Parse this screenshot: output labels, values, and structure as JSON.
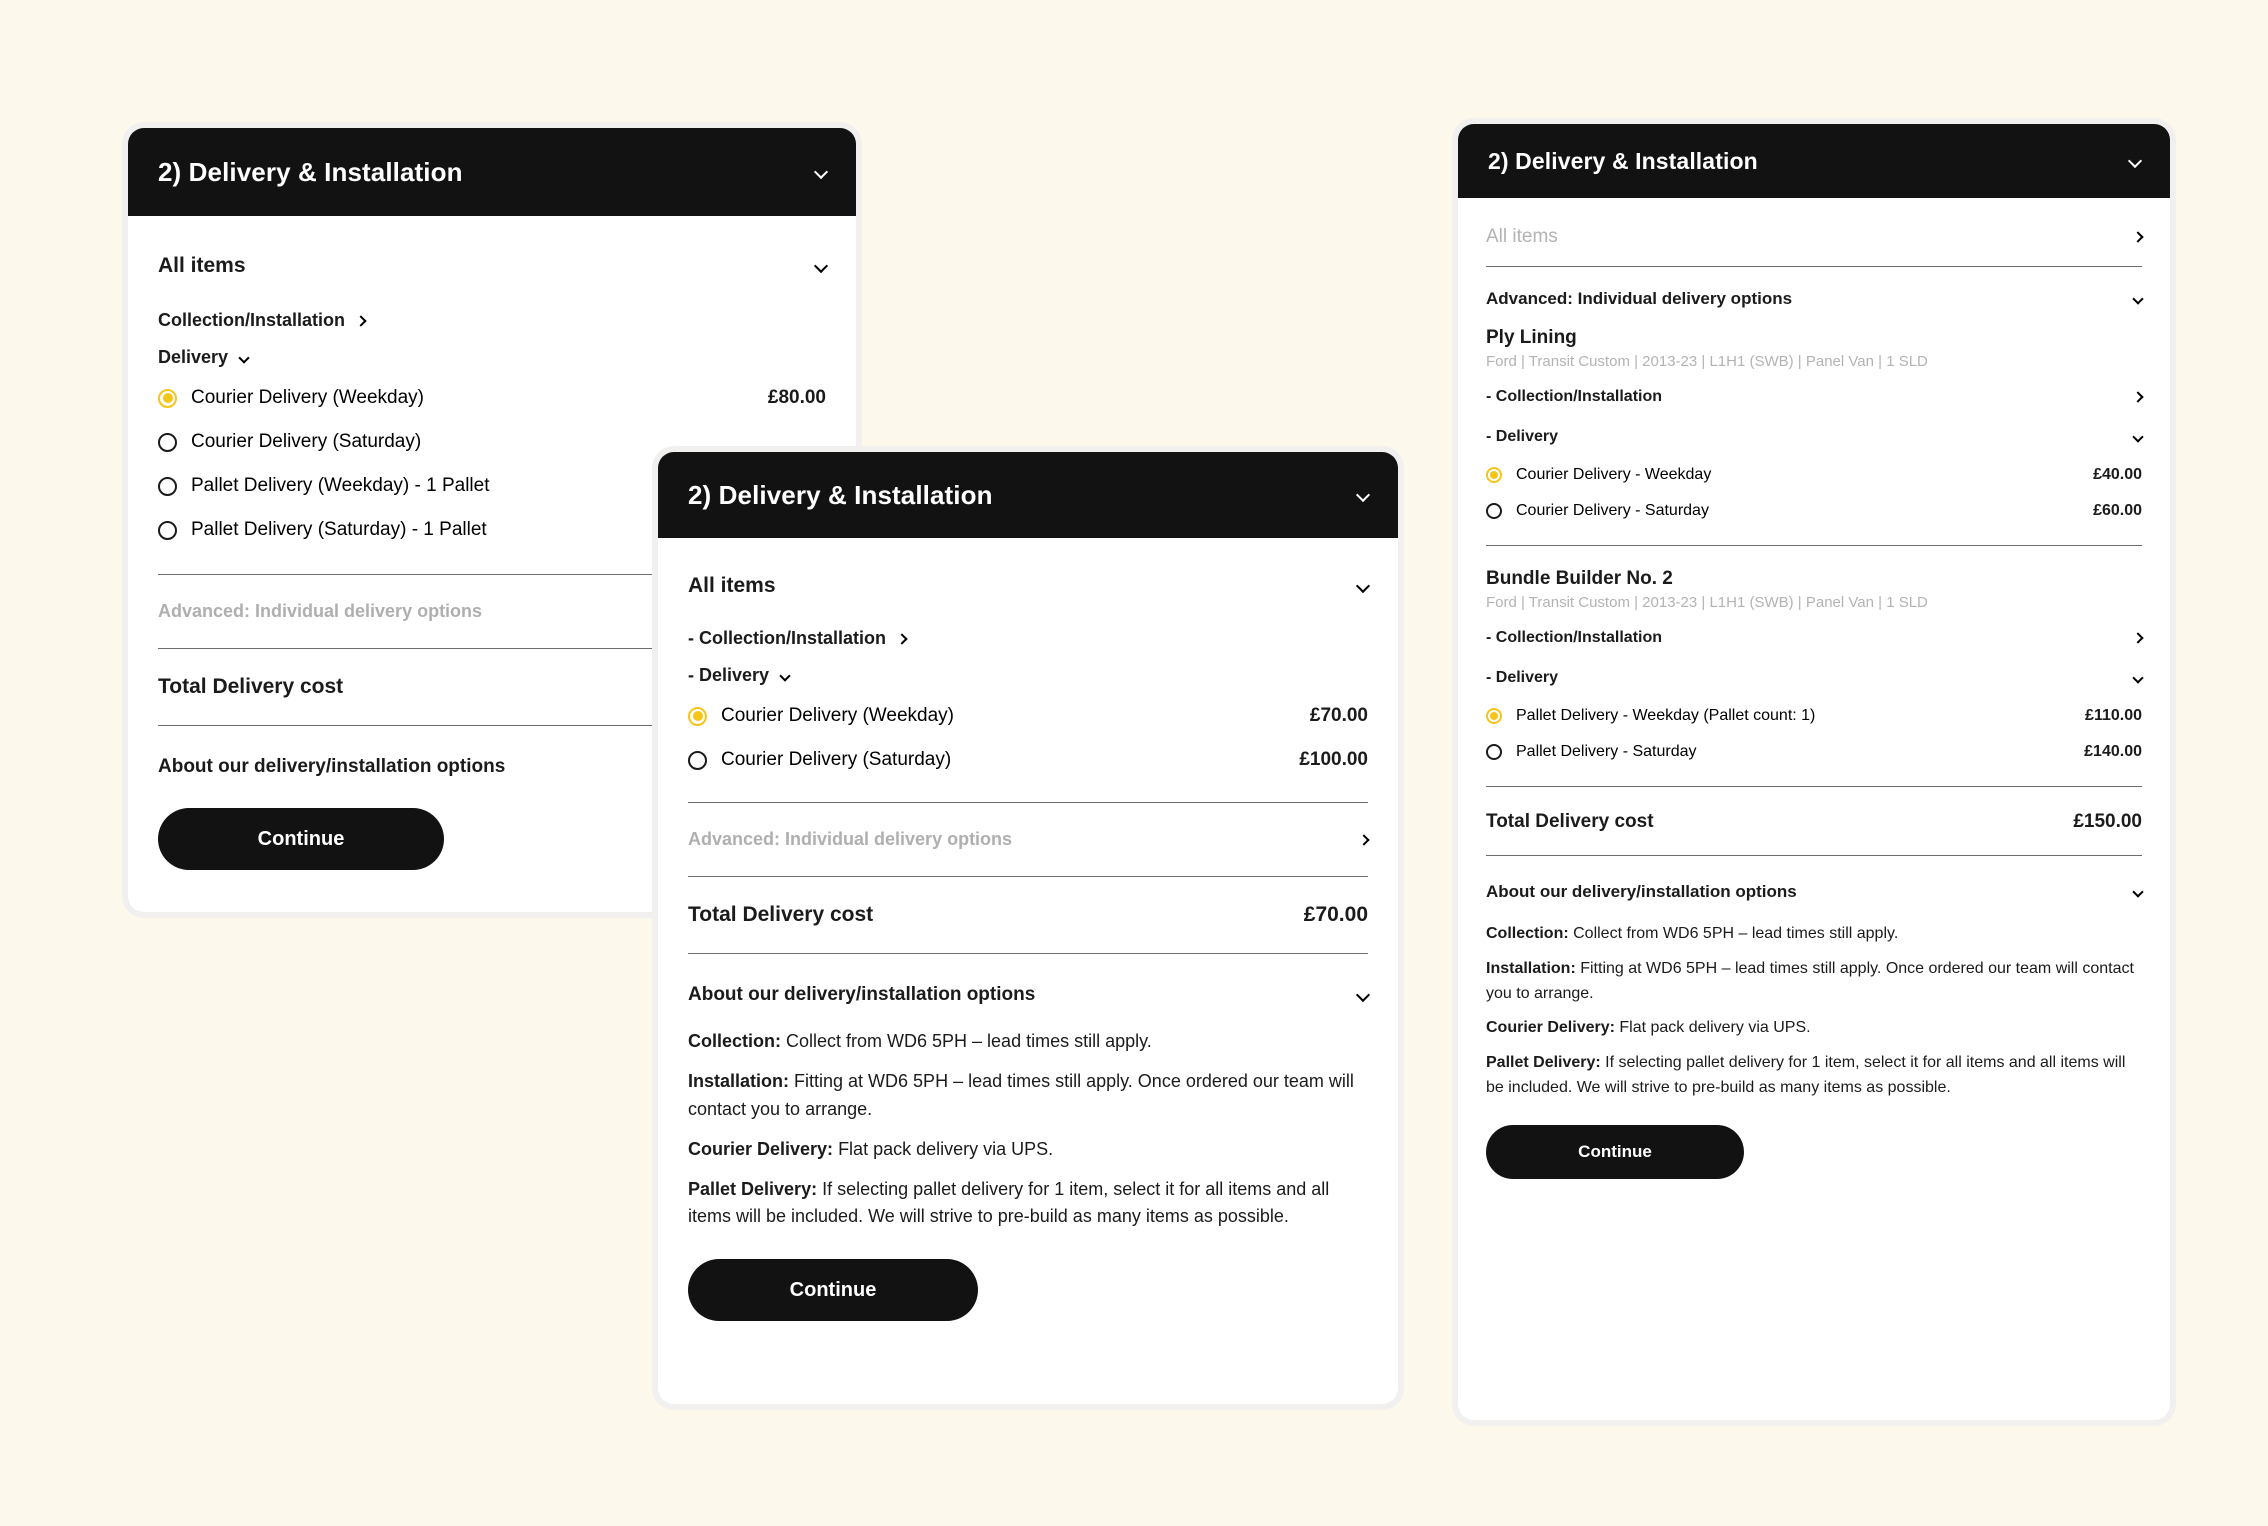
{
  "page": {
    "background_color": "#FDF8EC",
    "accent_color": "#F5C518",
    "header_bg_color": "#121212"
  },
  "card1": {
    "header_title": "2) Delivery & Installation",
    "all_items_label": "All items",
    "collection_label": "Collection/Installation",
    "delivery_label": "Delivery",
    "options": [
      {
        "label": "Courier Delivery (Weekday)",
        "price": "£80.00",
        "selected": true
      },
      {
        "label": "Courier Delivery (Saturday)",
        "price": "",
        "selected": false
      },
      {
        "label": "Pallet Delivery (Weekday) - 1 Pallet",
        "price": "",
        "selected": false
      },
      {
        "label": "Pallet Delivery (Saturday) - 1 Pallet",
        "price": "",
        "selected": false
      }
    ],
    "advanced_label": "Advanced: Individual delivery options",
    "total_label": "Total Delivery cost",
    "total_value": "",
    "about_label": "About our delivery/installation options",
    "continue_label": "Continue"
  },
  "card2": {
    "header_title": "2) Delivery & Installation",
    "all_items_label": "All items",
    "collection_label": "- Collection/Installation",
    "delivery_label": "- Delivery",
    "options": [
      {
        "label": "Courier Delivery (Weekday)",
        "price": "£70.00",
        "selected": true
      },
      {
        "label": "Courier Delivery (Saturday)",
        "price": "£100.00",
        "selected": false
      }
    ],
    "advanced_label": "Advanced: Individual delivery options",
    "total_label": "Total Delivery cost",
    "total_value": "£70.00",
    "about_label": "About our delivery/installation options",
    "info": [
      {
        "term": "Collection:",
        "text": " Collect from WD6 5PH – lead times still apply."
      },
      {
        "term": "Installation:",
        "text": " Fitting at WD6 5PH – lead times still apply. Once ordered our team will contact you to arrange."
      },
      {
        "term": "Courier Delivery:",
        "text": " Flat pack delivery via UPS."
      },
      {
        "term": "Pallet Delivery:",
        "text": " If selecting pallet delivery for 1 item, select it for all items and all items will be included. We will strive to pre-build as many items as possible."
      }
    ],
    "continue_label": "Continue"
  },
  "card3": {
    "header_title": "2) Delivery & Installation",
    "all_items_label": "All items",
    "advanced_label": "Advanced: Individual delivery options",
    "groups": [
      {
        "title": "Ply Lining",
        "subtitle": "Ford | Transit Custom | 2013-23 | L1H1 (SWB) | Panel Van | 1 SLD",
        "collection_label": "- Collection/Installation",
        "delivery_label": "- Delivery",
        "options": [
          {
            "label": "Courier Delivery - Weekday",
            "price": "£40.00",
            "selected": true
          },
          {
            "label": "Courier Delivery - Saturday",
            "price": "£60.00",
            "selected": false
          }
        ]
      },
      {
        "title": "Bundle Builder No. 2",
        "subtitle": "Ford | Transit Custom | 2013-23 | L1H1 (SWB) | Panel Van | 1 SLD",
        "collection_label": "- Collection/Installation",
        "delivery_label": "- Delivery",
        "options": [
          {
            "label": "Pallet Delivery - Weekday (Pallet count: 1)",
            "price": "£110.00",
            "selected": true
          },
          {
            "label": "Pallet Delivery - Saturday",
            "price": "£140.00",
            "selected": false
          }
        ]
      }
    ],
    "total_label": "Total Delivery cost",
    "total_value": "£150.00",
    "about_label": "About our delivery/installation options",
    "info": [
      {
        "term": "Collection:",
        "text": " Collect from WD6 5PH – lead times still apply."
      },
      {
        "term": "Installation:",
        "text": " Fitting at WD6 5PH – lead times still apply. Once ordered our team will contact you to arrange."
      },
      {
        "term": "Courier Delivery:",
        "text": " Flat pack delivery via UPS."
      },
      {
        "term": "Pallet Delivery:",
        "text": " If selecting pallet delivery for 1 item, select it for all items and all items will be included. We will strive to pre-build as many items as possible."
      }
    ],
    "continue_label": "Continue"
  }
}
